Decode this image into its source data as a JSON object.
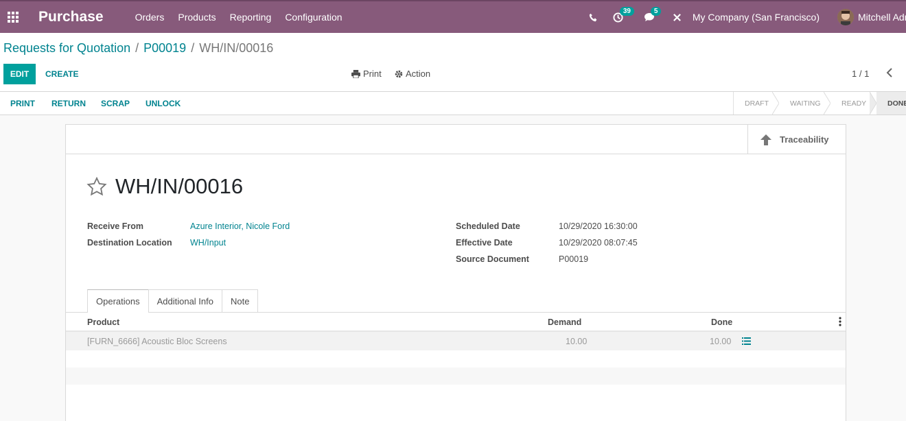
{
  "navbar": {
    "app_name": "Purchase",
    "menu": [
      "Orders",
      "Products",
      "Reporting",
      "Configuration"
    ],
    "activity_count": "39",
    "message_count": "5",
    "company": "My Company (San Francisco)",
    "user": "Mitchell Admin",
    "color": "#875a7b"
  },
  "breadcrumb": {
    "items": [
      "Requests for Quotation",
      "P00019"
    ],
    "current": "WH/IN/00016"
  },
  "control": {
    "edit_label": "EDIT",
    "create_label": "CREATE",
    "print_label": "Print",
    "action_label": "Action",
    "pager": "1 / 1"
  },
  "statusbar": {
    "buttons": [
      "PRINT",
      "RETURN",
      "SCRAP",
      "UNLOCK"
    ],
    "stages": [
      "DRAFT",
      "WAITING",
      "READY",
      "DONE"
    ],
    "current_stage": "DONE"
  },
  "sheet": {
    "traceability_label": "Traceability",
    "title": "WH/IN/00016",
    "fields_left": [
      {
        "label": "Receive From",
        "value": "Azure Interior, Nicole Ford"
      },
      {
        "label": "Destination Location",
        "value": "WH/Input"
      }
    ],
    "fields_right": [
      {
        "label": "Scheduled Date",
        "value": "10/29/2020 16:30:00"
      },
      {
        "label": "Effective Date",
        "value": "10/29/2020 08:07:45"
      },
      {
        "label": "Source Document",
        "value": "P00019"
      }
    ],
    "tabs": [
      "Operations",
      "Additional Info",
      "Note"
    ],
    "table": {
      "headers": [
        "Product",
        "Demand",
        "Done"
      ],
      "rows": [
        {
          "product": "[FURN_6666] Acoustic Bloc Screens",
          "demand": "10.00",
          "done": "10.00"
        }
      ]
    }
  },
  "accent": "#00a09d",
  "link_color": "#00838f"
}
